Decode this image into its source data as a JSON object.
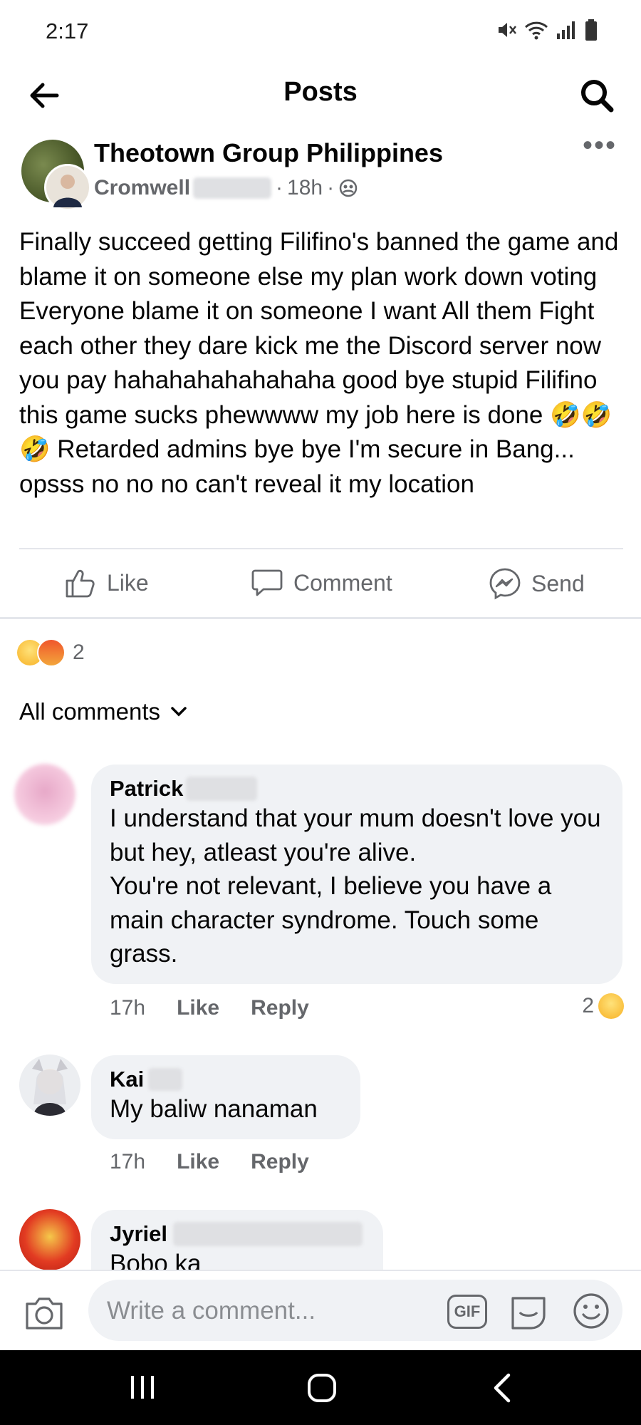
{
  "status": {
    "time": "2:17"
  },
  "header": {
    "title": "Posts"
  },
  "post": {
    "group_name": "Theotown Group Philippines",
    "author": "Cromwell",
    "time": "18h",
    "separator": "·",
    "body": "Finally succeed getting Filifino's banned the game and blame it on someone else my plan work down voting Everyone blame it on someone I want All them Fight each other they dare kick me the Discord server now you pay hahahahahahahaha good bye stupid Filifino this game sucks phewwww my job here is done 🤣🤣🤣 Retarded admins bye bye I'm secure in Bang... opsss no no no can't reveal it my location",
    "actions": {
      "like": "Like",
      "comment": "Comment",
      "send": "Send"
    },
    "reaction_count": "2"
  },
  "comments_filter": "All comments",
  "comments": [
    {
      "name": "Patrick",
      "text": "I understand that your mum doesn't love you but hey, atleast you're alive.\nYou're not relevant, I believe you have a main character syndrome. Touch some grass.",
      "time": "17h",
      "like": "Like",
      "reply": "Reply",
      "reaction_count": "2"
    },
    {
      "name": "Kai",
      "text": "My baliw nanaman",
      "time": "17h",
      "like": "Like",
      "reply": "Reply"
    },
    {
      "name": "Jyriel",
      "text": "Bobo ka"
    }
  ],
  "composer": {
    "placeholder": "Write a comment...",
    "gif": "GIF"
  },
  "colors": {
    "text": "#050505",
    "secondary": "#65676b",
    "bubble": "#f0f2f5",
    "divider": "#e4e6eb"
  },
  "icons": [
    "back-arrow-icon",
    "search-icon",
    "more-icon",
    "globe-icon",
    "like-icon",
    "comment-icon",
    "messenger-icon",
    "chevron-down-icon",
    "camera-icon",
    "gif-icon",
    "sticker-icon",
    "emoji-icon",
    "recent-apps-icon",
    "home-icon",
    "nav-back-icon"
  ]
}
